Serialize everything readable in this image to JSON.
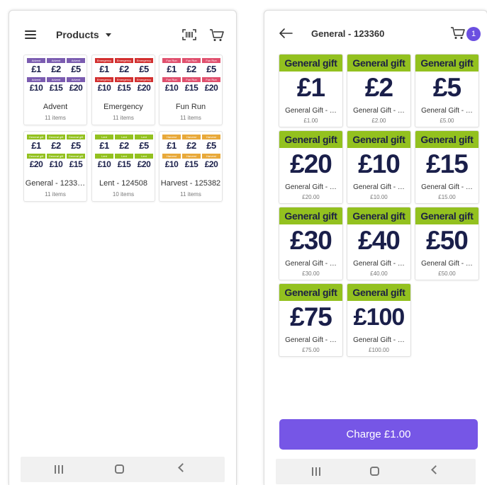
{
  "left_screen": {
    "header": {
      "title": "Products"
    },
    "categories": [
      {
        "name": "Advent",
        "count": "11 items",
        "strip_label": "Advent",
        "strip_color": "#7b5cb0",
        "amounts": [
          "£1",
          "£2",
          "£5",
          "£10",
          "£15",
          "£20"
        ]
      },
      {
        "name": "Emergency",
        "count": "11 items",
        "strip_label": "Emergency",
        "strip_color": "#d22f2f",
        "amounts": [
          "£1",
          "£2",
          "£5",
          "£10",
          "£15",
          "£20"
        ]
      },
      {
        "name": "Fun Run",
        "count": "11 items",
        "strip_label": "Fun Run",
        "strip_color": "#e0506e",
        "amounts": [
          "£1",
          "£2",
          "£5",
          "£10",
          "£15",
          "£20"
        ]
      },
      {
        "name": "General - 1233…",
        "count": "11 items",
        "strip_label": "General gift",
        "strip_color": "#93c11f",
        "amounts": [
          "£1",
          "£2",
          "£5",
          "£20",
          "£10",
          "£15"
        ]
      },
      {
        "name": "Lent - 124508",
        "count": "10 items",
        "strip_label": "Lent",
        "strip_color": "#93c11f",
        "amounts": [
          "£1",
          "£2",
          "£5",
          "£10",
          "£15",
          "£20"
        ]
      },
      {
        "name": "Harvest - 125382",
        "count": "11 items",
        "strip_label": "Harvest",
        "strip_color": "#e8a93a",
        "amounts": [
          "£1",
          "£2",
          "£5",
          "£10",
          "£15",
          "£20"
        ]
      }
    ]
  },
  "right_screen": {
    "header": {
      "title": "General - 123360",
      "cart_count": "1"
    },
    "products": [
      {
        "banner": "General gift",
        "amount": "£1",
        "name": "General Gift - …",
        "price": "£1.00"
      },
      {
        "banner": "General gift",
        "amount": "£2",
        "name": "General Gift - …",
        "price": "£2.00"
      },
      {
        "banner": "General gift",
        "amount": "£5",
        "name": "General Gift - …",
        "price": "£5.00"
      },
      {
        "banner": "General gift",
        "amount": "£20",
        "name": "General Gift - …",
        "price": "£20.00"
      },
      {
        "banner": "General gift",
        "amount": "£10",
        "name": "General Gift - …",
        "price": "£10.00"
      },
      {
        "banner": "General gift",
        "amount": "£15",
        "name": "General Gift - …",
        "price": "£15.00"
      },
      {
        "banner": "General gift",
        "amount": "£30",
        "name": "General Gift - …",
        "price": "£30.00"
      },
      {
        "banner": "General gift",
        "amount": "£40",
        "name": "General Gift - …",
        "price": "£40.00"
      },
      {
        "banner": "General gift",
        "amount": "£50",
        "name": "General Gift - …",
        "price": "£50.00"
      },
      {
        "banner": "General gift",
        "amount": "£75",
        "name": "General Gift - …",
        "price": "£75.00"
      },
      {
        "banner": "General gift",
        "amount": "£100",
        "name": "General Gift - …",
        "price": "£100.00"
      }
    ],
    "charge_label": "Charge £1.00"
  },
  "colors": {
    "accent": "#7656e6",
    "badge": "#6b4fe0",
    "gift_green": "#93c11f",
    "amount_navy": "#1a1f4a"
  },
  "icons": {
    "menu": "hamburger-icon",
    "barcode": "barcode-icon",
    "cart": "cart-icon",
    "back": "arrow-left-icon",
    "dropdown": "chevron-down-icon"
  }
}
